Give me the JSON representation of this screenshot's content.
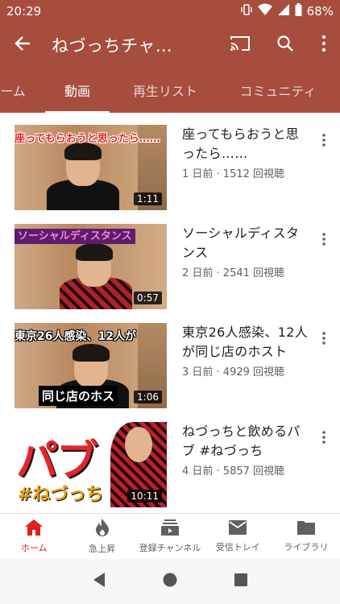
{
  "status_bar": {
    "time": "20:29",
    "battery": "68%"
  },
  "app_bar": {
    "title": "ねづっちチャ…"
  },
  "tabs": [
    {
      "label": "ーム",
      "active": false
    },
    {
      "label": "動画",
      "active": true
    },
    {
      "label": "再生リスト",
      "active": false
    },
    {
      "label": "コミュニティ",
      "active": false
    }
  ],
  "videos": [
    {
      "title": "座ってもらおうと思ったら……",
      "meta": "1 日前 · 1512 回視聴",
      "duration": "1:11",
      "thumb_caption": "座ってもらおうと思ったら……",
      "thumb_box": ""
    },
    {
      "title": "ソーシャルディスタンス",
      "meta": "2 日前 · 2541 回視聴",
      "duration": "0:57",
      "thumb_caption": "ソーシャルディスタンス",
      "thumb_box": ""
    },
    {
      "title": "東京26人感染、12人が同じ店のホスト",
      "meta": "3 日前 · 4929 回視聴",
      "duration": "1:06",
      "thumb_caption": "東京26人感染、12人が",
      "thumb_box": "同じ店のホス"
    },
    {
      "title": "ねづっちと飲めるパブ #ねづっち",
      "meta": "4 日前 · 5857 回視聴",
      "duration": "10:11",
      "thumb_caption": "パブ",
      "thumb_box": "#ねづっち"
    }
  ],
  "bottom_nav": [
    {
      "label": "ホーム",
      "icon": "home-icon",
      "active": true
    },
    {
      "label": "急上昇",
      "icon": "flame-icon",
      "active": false
    },
    {
      "label": "登録チャンネル",
      "icon": "subscriptions-icon",
      "active": false
    },
    {
      "label": "受信トレイ",
      "icon": "inbox-icon",
      "active": false
    },
    {
      "label": "ライブラリ",
      "icon": "folder-icon",
      "active": false
    }
  ],
  "colors": {
    "header": "#a64d3d",
    "active_nav": "#e31e1e"
  }
}
